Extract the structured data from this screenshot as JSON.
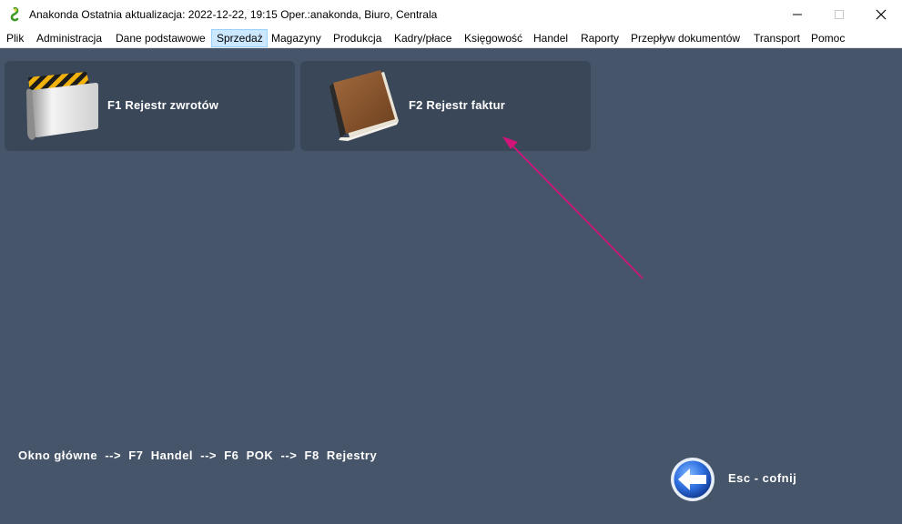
{
  "window": {
    "title": "Anakonda Ostatnia aktualizacja: 2022-12-22, 19:15 Oper.:anakonda, Biuro, Centrala",
    "app_icon": "snake-logo-icon",
    "controls": {
      "minimize": "minimize-icon",
      "maximize": "maximize-icon",
      "close": "close-icon"
    }
  },
  "menu": {
    "items": [
      {
        "label": "Plik"
      },
      {
        "label": "Administracja"
      },
      {
        "label": "Dane podstawowe"
      },
      {
        "label": "Sprzedaż",
        "active": true
      },
      {
        "label": "Magazyny"
      },
      {
        "label": "Produkcja"
      },
      {
        "label": "Kadry/płace"
      },
      {
        "label": "Księgowość"
      },
      {
        "label": "Handel"
      },
      {
        "label": "Raporty"
      },
      {
        "label": "Przepływ dokumentów"
      },
      {
        "label": "Transport"
      },
      {
        "label": "Pomoc"
      }
    ]
  },
  "tiles": [
    {
      "label": "F1  Rejestr zwrotów",
      "icon": "folder-caution-icon"
    },
    {
      "label": "F2  Rejestr faktur",
      "icon": "book-icon"
    }
  ],
  "breadcrumb": "Okno główne  -->  F7  Handel  -->  F6  POK  -->  F8  Rejestry",
  "back": {
    "label": "Esc - cofnij",
    "icon": "back-arrow-icon"
  },
  "colors": {
    "background": "#465569",
    "tile": "#3a4758",
    "annotation_arrow": "#d0157a",
    "active_menu": "#cce8ff"
  }
}
